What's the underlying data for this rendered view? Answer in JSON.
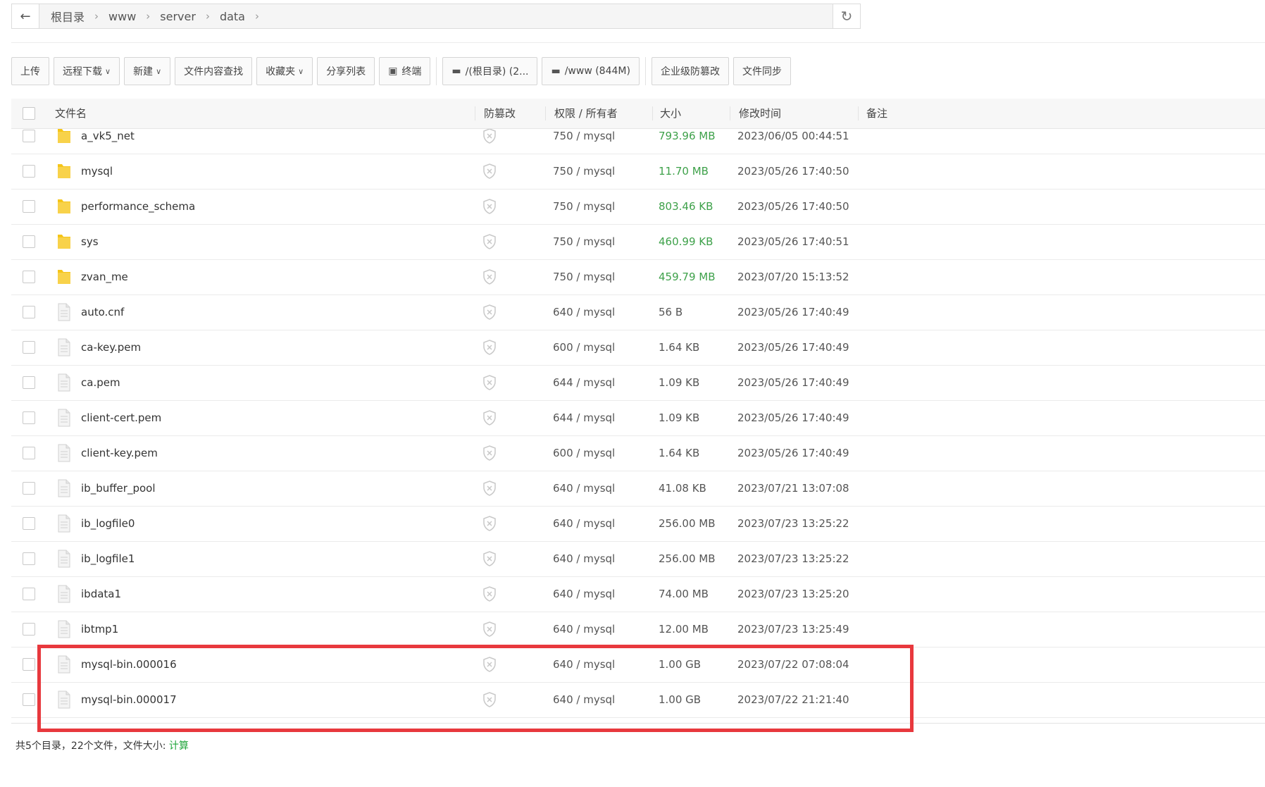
{
  "breadcrumb": {
    "items": [
      "根目录",
      "www",
      "server",
      "data"
    ],
    "separator": "›"
  },
  "toolbar": {
    "upload": "上传",
    "remote_download": "远程下载",
    "new": "新建",
    "content_search": "文件内容查找",
    "favorites": "收藏夹",
    "share_list": "分享列表",
    "terminal": "终端",
    "disk_root": "/(根目录) (2...",
    "disk_www": "/www (844M)",
    "enterprise_tamper": "企业级防篡改",
    "file_sync": "文件同步"
  },
  "columns": {
    "name": "文件名",
    "tamper": "防篡改",
    "perm_owner": "权限 / 所有者",
    "size": "大小",
    "mtime": "修改时间",
    "remark": "备注"
  },
  "files": [
    {
      "name": "a_vk5_net",
      "type": "dir",
      "perm": "750 / mysql",
      "size": "793.96 MB",
      "mtime": "2023/06/05 00:44:51"
    },
    {
      "name": "mysql",
      "type": "dir",
      "perm": "750 / mysql",
      "size": "11.70 MB",
      "mtime": "2023/05/26 17:40:50"
    },
    {
      "name": "performance_schema",
      "type": "dir",
      "perm": "750 / mysql",
      "size": "803.46 KB",
      "mtime": "2023/05/26 17:40:50"
    },
    {
      "name": "sys",
      "type": "dir",
      "perm": "750 / mysql",
      "size": "460.99 KB",
      "mtime": "2023/05/26 17:40:51"
    },
    {
      "name": "zvan_me",
      "type": "dir",
      "perm": "750 / mysql",
      "size": "459.79 MB",
      "mtime": "2023/07/20 15:13:52"
    },
    {
      "name": "auto.cnf",
      "type": "file",
      "perm": "640 / mysql",
      "size": "56 B",
      "mtime": "2023/05/26 17:40:49"
    },
    {
      "name": "ca-key.pem",
      "type": "file",
      "perm": "600 / mysql",
      "size": "1.64 KB",
      "mtime": "2023/05/26 17:40:49"
    },
    {
      "name": "ca.pem",
      "type": "file",
      "perm": "644 / mysql",
      "size": "1.09 KB",
      "mtime": "2023/05/26 17:40:49"
    },
    {
      "name": "client-cert.pem",
      "type": "file",
      "perm": "644 / mysql",
      "size": "1.09 KB",
      "mtime": "2023/05/26 17:40:49"
    },
    {
      "name": "client-key.pem",
      "type": "file",
      "perm": "600 / mysql",
      "size": "1.64 KB",
      "mtime": "2023/05/26 17:40:49"
    },
    {
      "name": "ib_buffer_pool",
      "type": "file",
      "perm": "640 / mysql",
      "size": "41.08 KB",
      "mtime": "2023/07/21 13:07:08"
    },
    {
      "name": "ib_logfile0",
      "type": "file",
      "perm": "640 / mysql",
      "size": "256.00 MB",
      "mtime": "2023/07/23 13:25:22"
    },
    {
      "name": "ib_logfile1",
      "type": "file",
      "perm": "640 / mysql",
      "size": "256.00 MB",
      "mtime": "2023/07/23 13:25:22"
    },
    {
      "name": "ibdata1",
      "type": "file",
      "perm": "640 / mysql",
      "size": "74.00 MB",
      "mtime": "2023/07/23 13:25:20"
    },
    {
      "name": "ibtmp1",
      "type": "file",
      "perm": "640 / mysql",
      "size": "12.00 MB",
      "mtime": "2023/07/23 13:25:49"
    },
    {
      "name": "mysql-bin.000016",
      "type": "file",
      "perm": "640 / mysql",
      "size": "1.00 GB",
      "mtime": "2023/07/22 07:08:04"
    },
    {
      "name": "mysql-bin.000017",
      "type": "file",
      "perm": "640 / mysql",
      "size": "1.00 GB",
      "mtime": "2023/07/22 21:21:40"
    }
  ],
  "footer": {
    "summary": "共5个目录，22个文件，文件大小:",
    "calc": "计算"
  },
  "colors": {
    "accent_green": "#20a53a",
    "dir_size_green": "#3ea14a",
    "highlight_red": "#e8383d",
    "folder_yellow": "#f5c518"
  }
}
